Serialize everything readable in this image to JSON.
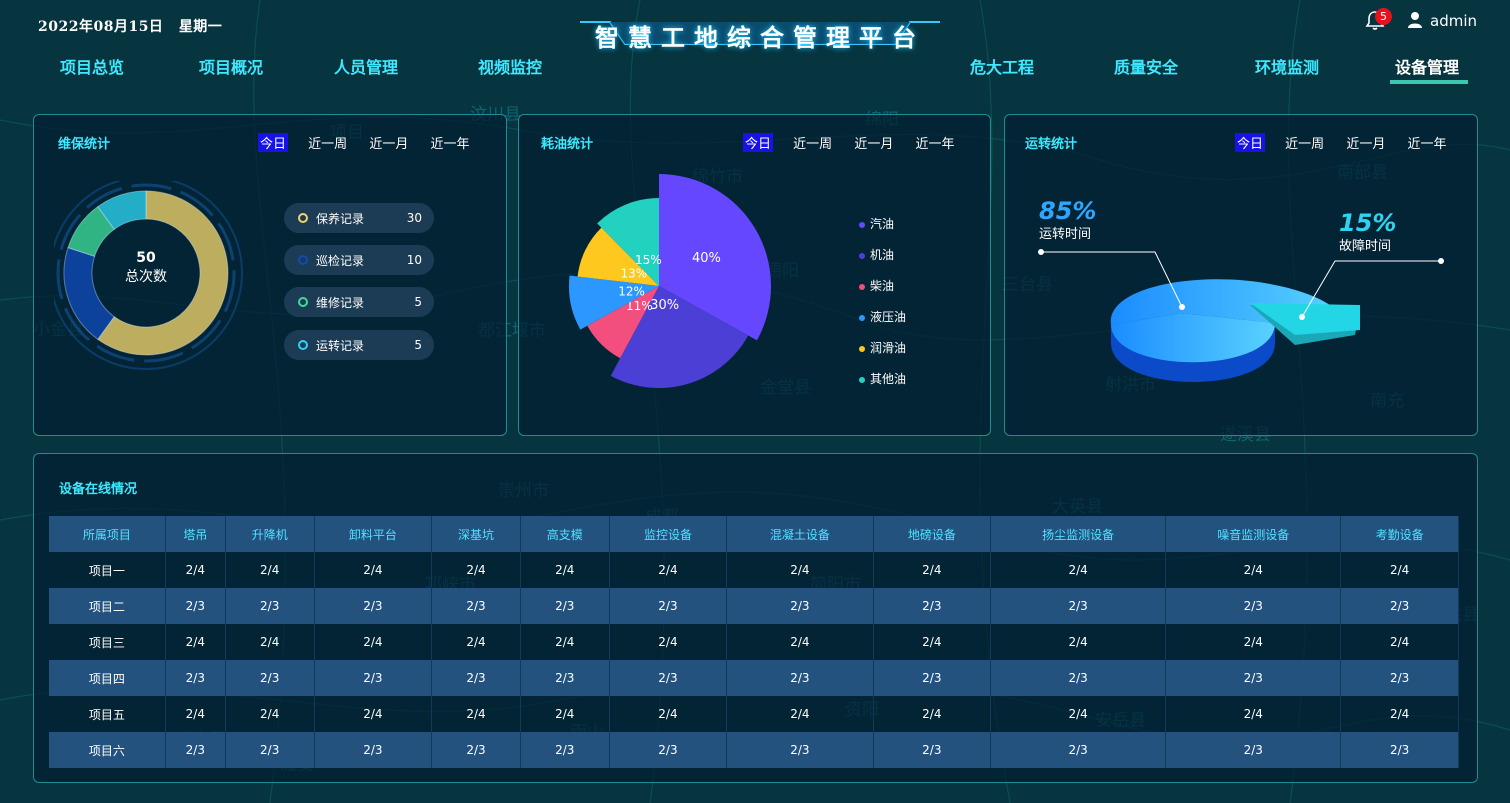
{
  "header": {
    "date": "2022年08月15日",
    "weekday": "星期一",
    "title": "智慧工地综合管理平台",
    "notifications": "5",
    "user": "admin",
    "nav_left": [
      "项目总览",
      "项目概况",
      "人员管理",
      "视频监控"
    ],
    "nav_right": [
      "危大工程",
      "质量安全",
      "环境监测",
      "设备管理"
    ],
    "active_nav": "设备管理",
    "icons": {
      "bell": "bell-icon",
      "user": "user-icon"
    }
  },
  "map_labels": [
    "汶川县",
    "绵阳",
    "绵竹市",
    "德阳",
    "都江堰市",
    "金堂县",
    "小金县",
    "三台县",
    "南部县",
    "射洪市",
    "南充",
    "遂溪县",
    "崇州市",
    "成都",
    "大英县",
    "邛崃市",
    "简阳市",
    "宝兴县",
    "资阳",
    "安岳县",
    "天全县",
    "雅安",
    "武胜县",
    "项目",
    "雨山",
    "蒲江县"
  ],
  "tabs": [
    "今日",
    "近一周",
    "近一月",
    "近一年"
  ],
  "maintenance": {
    "title": "维保统计",
    "total_value": "50",
    "total_label": "总次数",
    "items": [
      {
        "label": "保养记录",
        "value": 30,
        "color": "#f2d36b"
      },
      {
        "label": "巡检记录",
        "value": 10,
        "color": "#0f4ab8"
      },
      {
        "label": "维修记录",
        "value": 5,
        "color": "#3ddc9a"
      },
      {
        "label": "运转记录",
        "value": 5,
        "color": "#2ed3f0"
      }
    ]
  },
  "fuel": {
    "title": "耗油统计",
    "items": [
      {
        "label": "汽油",
        "percent": 40,
        "color": "#6547ff"
      },
      {
        "label": "机油",
        "percent": 30,
        "color": "#4b3fd6"
      },
      {
        "label": "柴油",
        "percent": 11,
        "color": "#f24e7e"
      },
      {
        "label": "液压油",
        "percent": 12,
        "color": "#2b97ff"
      },
      {
        "label": "润滑油",
        "percent": 13,
        "color": "#ffc81e"
      },
      {
        "label": "其他油",
        "percent": 15,
        "color": "#22d1c0"
      }
    ],
    "labels": [
      "40%",
      "30%",
      "11%",
      "12%",
      "13%",
      "15%"
    ]
  },
  "operation": {
    "title": "运转统计",
    "run_percent": "85%",
    "run_label": "运转时间",
    "fault_percent": "15%",
    "fault_label": "故障时间",
    "run_value": 85,
    "fault_value": 15
  },
  "online": {
    "title": "设备在线情况",
    "headers": [
      "所属项目",
      "塔吊",
      "升降机",
      "卸料平台",
      "深基坑",
      "高支模",
      "监控设备",
      "混凝土设备",
      "地磅设备",
      "扬尘监测设备",
      "噪音监测设备",
      "考勤设备"
    ],
    "rows": [
      [
        "项目一",
        "2/4",
        "2/4",
        "2/4",
        "2/4",
        "2/4",
        "2/4",
        "2/4",
        "2/4",
        "2/4",
        "2/4",
        "2/4"
      ],
      [
        "项目二",
        "2/3",
        "2/3",
        "2/3",
        "2/3",
        "2/3",
        "2/3",
        "2/3",
        "2/3",
        "2/3",
        "2/3",
        "2/3"
      ],
      [
        "项目三",
        "2/4",
        "2/4",
        "2/4",
        "2/4",
        "2/4",
        "2/4",
        "2/4",
        "2/4",
        "2/4",
        "2/4",
        "2/4"
      ],
      [
        "项目四",
        "2/3",
        "2/3",
        "2/3",
        "2/3",
        "2/3",
        "2/3",
        "2/3",
        "2/3",
        "2/3",
        "2/3",
        "2/3"
      ],
      [
        "项目五",
        "2/4",
        "2/4",
        "2/4",
        "2/4",
        "2/4",
        "2/4",
        "2/4",
        "2/4",
        "2/4",
        "2/4",
        "2/4"
      ],
      [
        "项目六",
        "2/3",
        "2/3",
        "2/3",
        "2/3",
        "2/3",
        "2/3",
        "2/3",
        "2/3",
        "2/3",
        "2/3",
        "2/3"
      ]
    ]
  },
  "colors": {
    "accent": "#3ee9ff",
    "active_tab": "#1612e8",
    "border": "#1e8c94"
  }
}
